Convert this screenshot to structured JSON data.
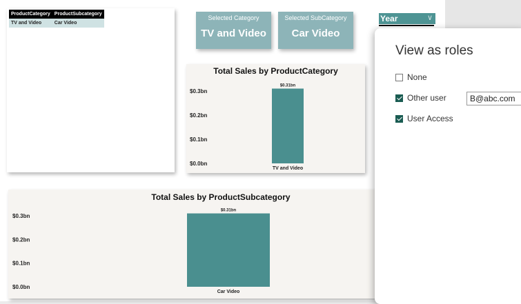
{
  "table": {
    "headers": [
      "ProductCategory",
      "ProductSubcategory"
    ],
    "rows": [
      [
        "TV and Video",
        "Car Video"
      ]
    ]
  },
  "cards": [
    {
      "label": "Selected Category",
      "value": "TV and Video"
    },
    {
      "label": "Selected SubCategory",
      "value": "Car Video"
    }
  ],
  "slicer": {
    "title": "Year"
  },
  "roles_dialog": {
    "title": "View as roles",
    "options": [
      {
        "label": "None",
        "checked": false
      },
      {
        "label": "Other user",
        "checked": true
      },
      {
        "label": "User Access",
        "checked": true
      }
    ],
    "other_user_value": "B@abc.com"
  },
  "chart_data": [
    {
      "type": "bar",
      "title": "Total Sales by ProductCategory",
      "categories": [
        "TV and Video"
      ],
      "values": [
        0.31
      ],
      "data_labels": [
        "$0.31bn"
      ],
      "yticks": [
        "$0.0bn",
        "$0.1bn",
        "$0.2bn",
        "$0.3bn"
      ],
      "ylim": [
        0,
        0.3
      ],
      "color": "#4a8f8f"
    },
    {
      "type": "bar",
      "title": "Total Sales by ProductSubcategory",
      "categories": [
        "Car Video"
      ],
      "values": [
        0.31
      ],
      "data_labels": [
        "$0.31bn"
      ],
      "yticks": [
        "$0.0bn",
        "$0.1bn",
        "$0.2bn",
        "$0.3bn"
      ],
      "ylim": [
        0,
        0.3
      ],
      "color": "#4a8f8f"
    }
  ]
}
